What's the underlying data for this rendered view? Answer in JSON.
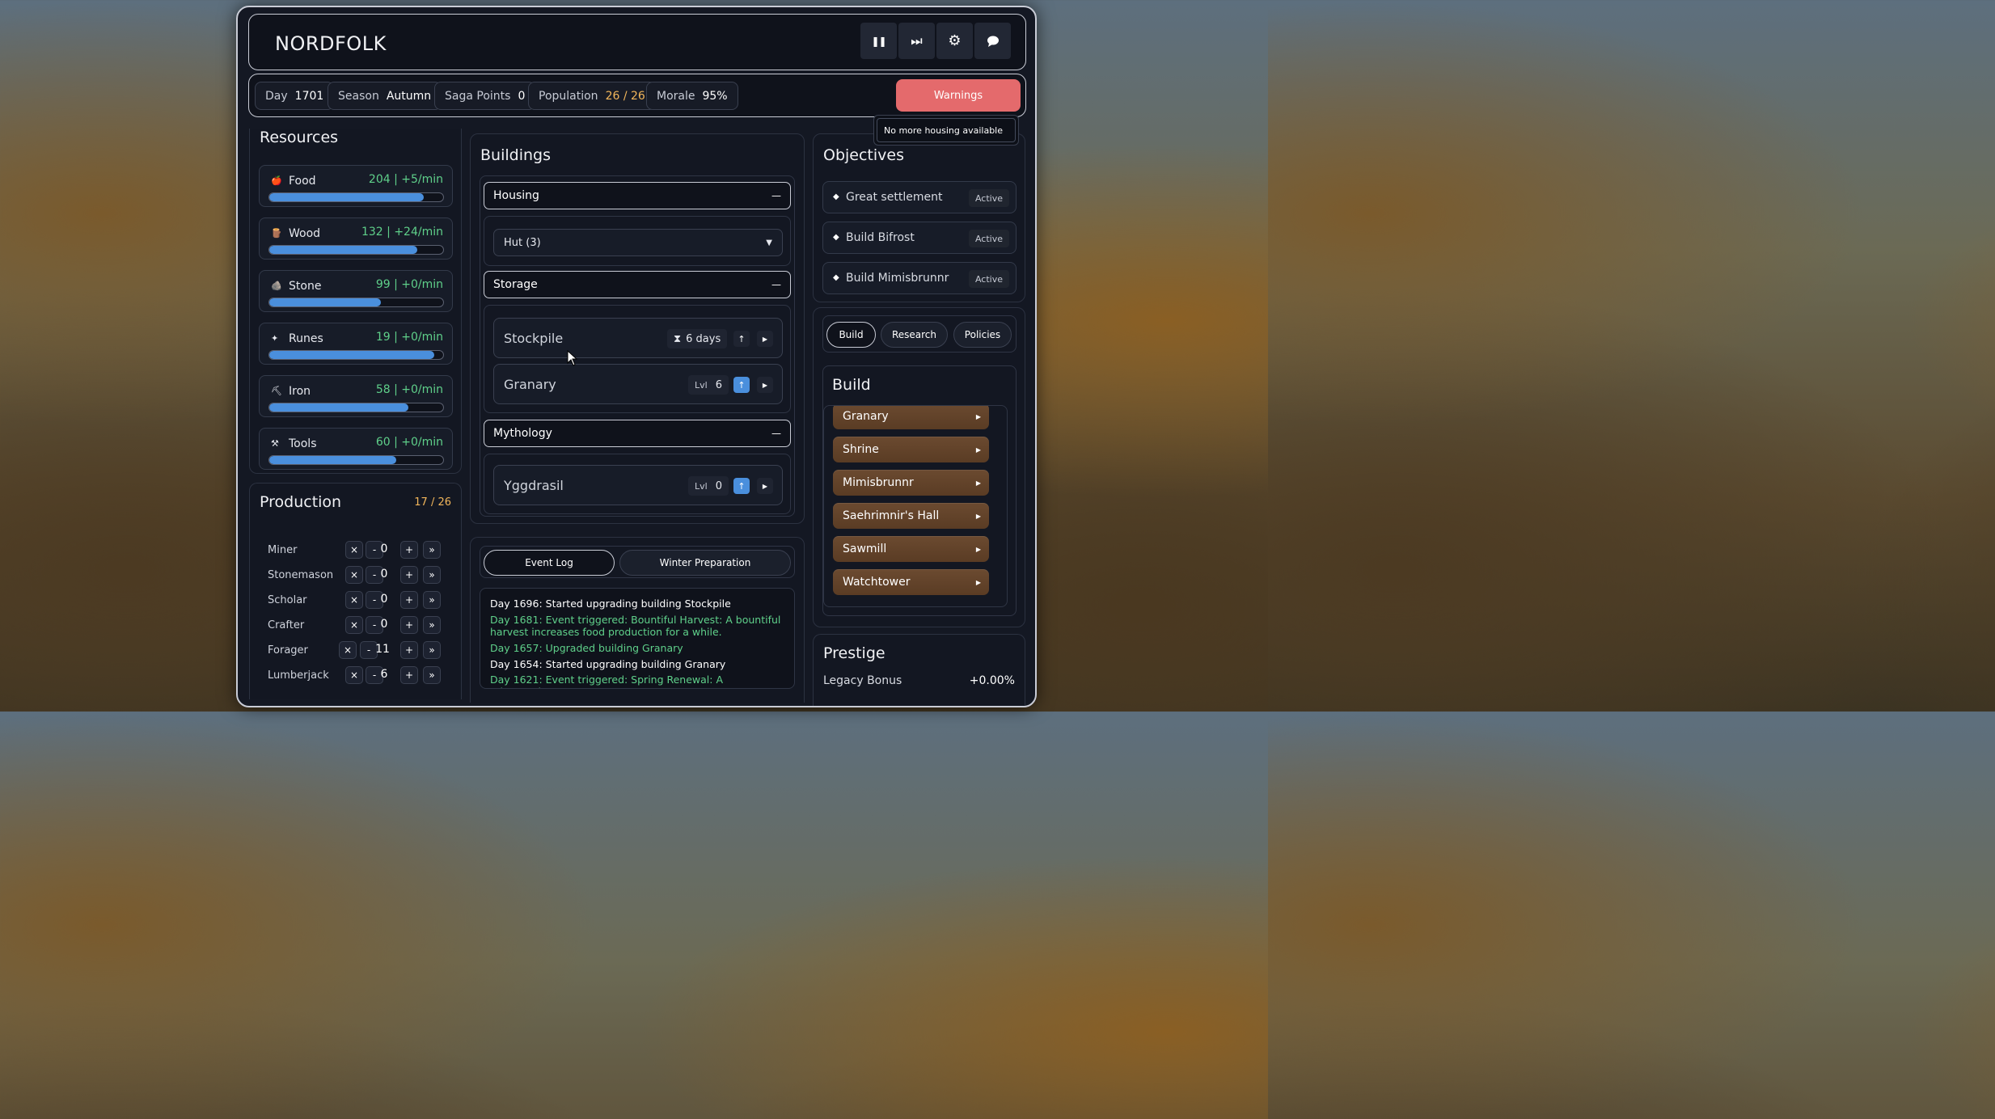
{
  "game": {
    "title": "NORDFOLK",
    "controls": [
      {
        "name": "pause-icon",
        "glyph": "❚❚"
      },
      {
        "name": "skip-forward-icon",
        "glyph": "⏭"
      },
      {
        "name": "gear-icon",
        "glyph": "⚙"
      },
      {
        "name": "chat-bubble-icon",
        "glyph": "●"
      }
    ]
  },
  "status": {
    "day_label": "Day",
    "day": "1701",
    "season_label": "Season",
    "season": "Autumn",
    "saga_label": "Saga Points",
    "saga": "0",
    "population_label": "Population",
    "population": "26 / 26",
    "morale_label": "Morale",
    "morale": "95%",
    "warnings_label": "Warnings",
    "warning_tooltip": "No more housing available"
  },
  "resources": {
    "title": "Resources",
    "items": [
      {
        "name": "Food",
        "value": "204 | +5/min",
        "fill": 0.89,
        "icon": "🍎"
      },
      {
        "name": "Wood",
        "value": "132 | +24/min",
        "fill": 0.85,
        "icon": "🪵"
      },
      {
        "name": "Stone",
        "value": "99 | +0/min",
        "fill": 0.64,
        "icon": "🪨"
      },
      {
        "name": "Runes",
        "value": "19 | +0/min",
        "fill": 0.95,
        "icon": "✦"
      },
      {
        "name": "Iron",
        "value": "58 | +0/min",
        "fill": 0.8,
        "icon": "⛏"
      },
      {
        "name": "Tools",
        "value": "60 | +0/min",
        "fill": 0.73,
        "icon": "⚒"
      }
    ]
  },
  "production": {
    "title": "Production",
    "count": "17 / 26",
    "rows": [
      {
        "name": "Miner",
        "value": "0"
      },
      {
        "name": "Stonemason",
        "value": "0"
      },
      {
        "name": "Scholar",
        "value": "0"
      },
      {
        "name": "Crafter",
        "value": "0"
      },
      {
        "name": "Forager",
        "value": "11"
      },
      {
        "name": "Lumberjack",
        "value": "6"
      }
    ],
    "buttons": {
      "clear": "×",
      "minus": "-",
      "plus": "+",
      "max": "»"
    }
  },
  "buildings": {
    "title": "Buildings",
    "housing": {
      "label": "Housing",
      "collapse": "—",
      "select_value": "Hut (3)"
    },
    "storage": {
      "label": "Storage",
      "collapse": "—",
      "stockpile": {
        "name": "Stockpile",
        "timer": "6 days"
      },
      "granary": {
        "name": "Granary",
        "lvl_label": "Lvl",
        "lvl": "6"
      }
    },
    "mythology": {
      "label": "Mythology",
      "collapse": "—",
      "yggdrasil": {
        "name": "Yggdrasil",
        "lvl_label": "Lvl",
        "lvl": "0"
      }
    }
  },
  "log": {
    "tabs": [
      "Event Log",
      "Winter Preparation"
    ],
    "entries": [
      {
        "text": "Day 1696: Started upgrading building Stockpile",
        "color": "#ffffff"
      },
      {
        "text": "Day 1681: Event triggered: Bountiful Harvest: A bountiful harvest increases food production for a while.",
        "color": "#5fd08a"
      },
      {
        "text": "Day 1657: Upgraded building Granary",
        "color": "#5fd08a"
      },
      {
        "text": "Day 1654: Started upgrading building Granary",
        "color": "#ffffff"
      },
      {
        "text": "Day 1621: Event triggered: Spring Renewal: A rejuvenating",
        "color": "#5fd08a"
      }
    ]
  },
  "objectives": {
    "title": "Objectives",
    "items": [
      {
        "name": "Great settlement",
        "status": "Active"
      },
      {
        "name": "Build Bifrost",
        "status": "Active"
      },
      {
        "name": "Build Mimisbrunnr",
        "status": "Active"
      }
    ]
  },
  "actions": {
    "tabs": [
      "Build",
      "Research",
      "Policies"
    ],
    "build_title": "Build",
    "build_items": [
      "Granary",
      "Shrine",
      "Mimisbrunnr",
      "Saehrimnir's Hall",
      "Sawmill",
      "Watchtower"
    ]
  },
  "prestige": {
    "title": "Prestige",
    "legacy_label": "Legacy Bonus",
    "legacy_value": "+0.00%"
  },
  "colors": {
    "accent_blue": "#4a8fdd",
    "positive_green": "#5fd08a",
    "warning_red": "#e46a6c",
    "highlight_orange": "#f2b65b",
    "build_brown": "#6b4a30"
  }
}
